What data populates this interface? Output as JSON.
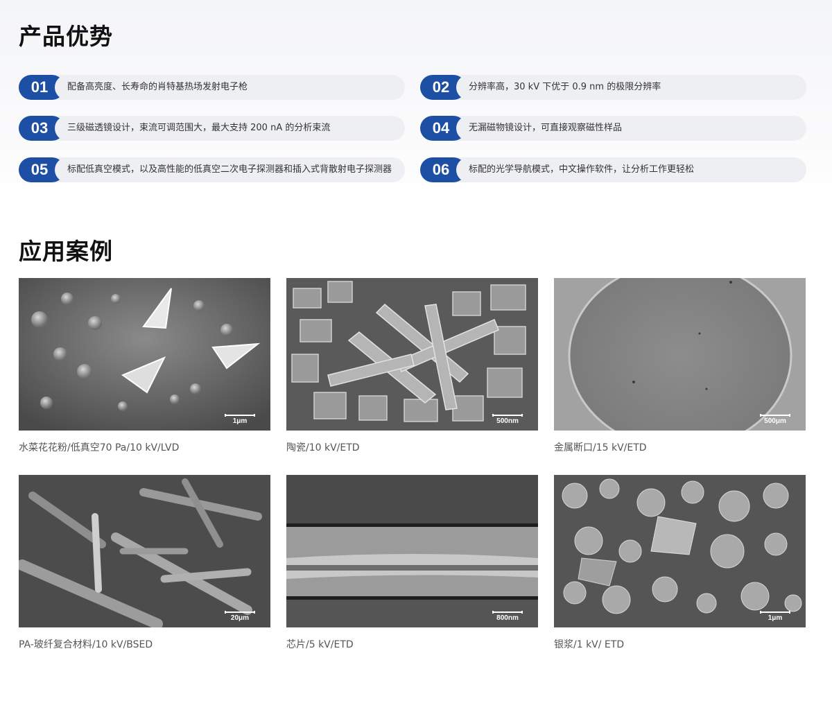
{
  "advantages": {
    "title": "产品优势",
    "items": [
      {
        "num": "01",
        "text": "配备高亮度、长寿命的肖特基热场发射电子枪"
      },
      {
        "num": "02",
        "text": "分辨率高，30 kV 下优于 0.9 nm 的极限分辨率"
      },
      {
        "num": "03",
        "text": "三级磁透镜设计，束流可调范围大，最大支持 200 nA 的分析束流"
      },
      {
        "num": "04",
        "text": "无漏磁物镜设计，可直接观察磁性样品"
      },
      {
        "num": "05",
        "text": "标配低真空模式，以及高性能的低真空二次电子探测器和插入式背散射电子探测器"
      },
      {
        "num": "06",
        "text": "标配的光学导航模式，中文操作软件，让分析工作更轻松"
      }
    ]
  },
  "applications": {
    "title": "应用案例",
    "cases": [
      {
        "caption": "水菜花花粉/低真空70 Pa/10 kV/LVD",
        "scale": "1μm"
      },
      {
        "caption": "陶瓷/10 kV/ETD",
        "scale": "500nm"
      },
      {
        "caption": "金属断口/15 kV/ETD",
        "scale": "500μm"
      },
      {
        "caption": "PA-玻纤复合材料/10 kV/BSED",
        "scale": "20μm"
      },
      {
        "caption": "芯片/5 kV/ETD",
        "scale": "800nm"
      },
      {
        "caption": "银浆/1 kV/ ETD",
        "scale": "1μm"
      }
    ]
  },
  "colors": {
    "accent": "#1d4fa4",
    "item_bg": "#eeeff2"
  }
}
